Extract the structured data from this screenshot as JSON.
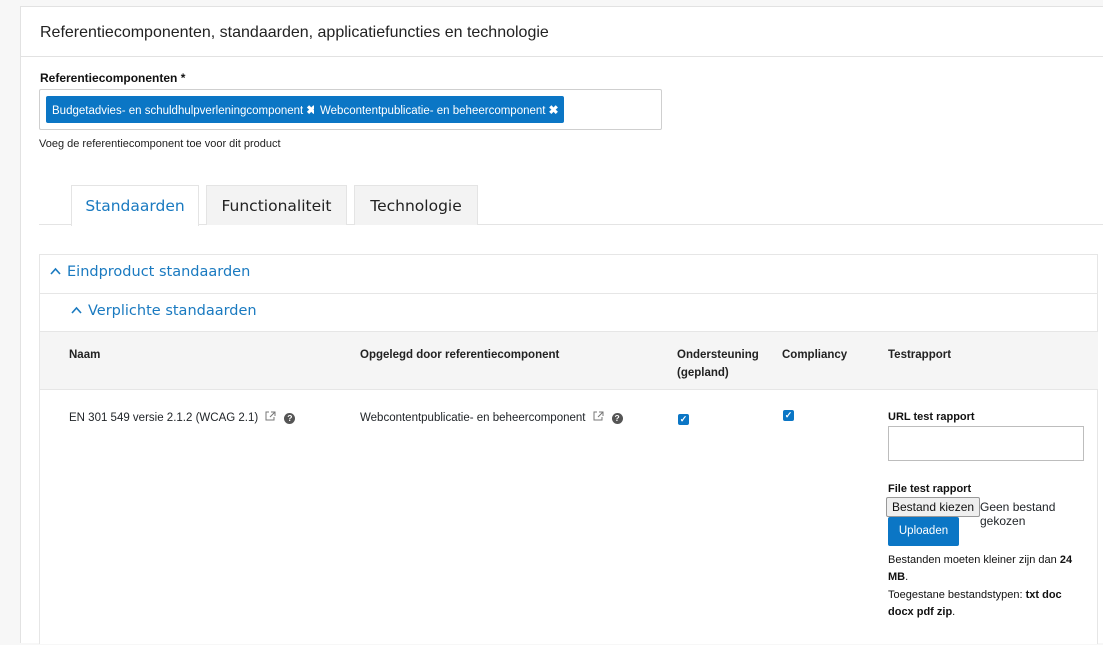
{
  "panel": {
    "title": "Referentiecomponenten, standaarden, applicatiefuncties en technologie"
  },
  "reference": {
    "label": "Referentiecomponenten *",
    "tags": [
      {
        "label": "Budgetadvies- en schuldhulpverleningcomponent",
        "remove": "✖"
      },
      {
        "label": "Webcontentpublicatie- en beheercomponent",
        "remove": "✖"
      }
    ],
    "hint": "Voeg de referentiecomponent toe voor dit product"
  },
  "tabs": [
    {
      "label": "Standaarden",
      "active": true
    },
    {
      "label": "Functionaliteit",
      "active": false
    },
    {
      "label": "Technologie",
      "active": false
    }
  ],
  "accordion": {
    "outer_title": "Eindproduct standaarden",
    "inner_title": "Verplichte standaarden",
    "chevron": "^"
  },
  "table": {
    "headers": {
      "name": "Naam",
      "imposed": "Opgelegd door referentiecomponent",
      "support_line1": "Ondersteuning",
      "support_line2": "(gepland)",
      "compliancy": "Compliancy",
      "testreport": "Testrapport"
    },
    "rows": [
      {
        "name": "EN 301 549 versie 2.1.2 (WCAG 2.1)",
        "imposed": "Webcontentpublicatie- en beheercomponent",
        "support": true,
        "compliancy": true,
        "url_label": "URL test rapport",
        "url_value": "",
        "file_label": "File test rapport",
        "file_button": "Bestand kiezen",
        "file_status": "Geen bestand gekozen",
        "upload_button": "Uploaden",
        "size_note_prefix": "Bestanden moeten kleiner zijn dan ",
        "size_note_value": "24 MB",
        "size_note_suffix": ".",
        "types_prefix": "Toegestane bestandstypen: ",
        "types_value": "txt doc docx pdf zip",
        "types_suffix": "."
      }
    ]
  },
  "icons": {
    "external": "external-link-icon",
    "help": "question-circle-icon",
    "check": "checkmark-icon"
  },
  "colors": {
    "accent": "#0b76c5",
    "link": "#1a7ac0"
  }
}
